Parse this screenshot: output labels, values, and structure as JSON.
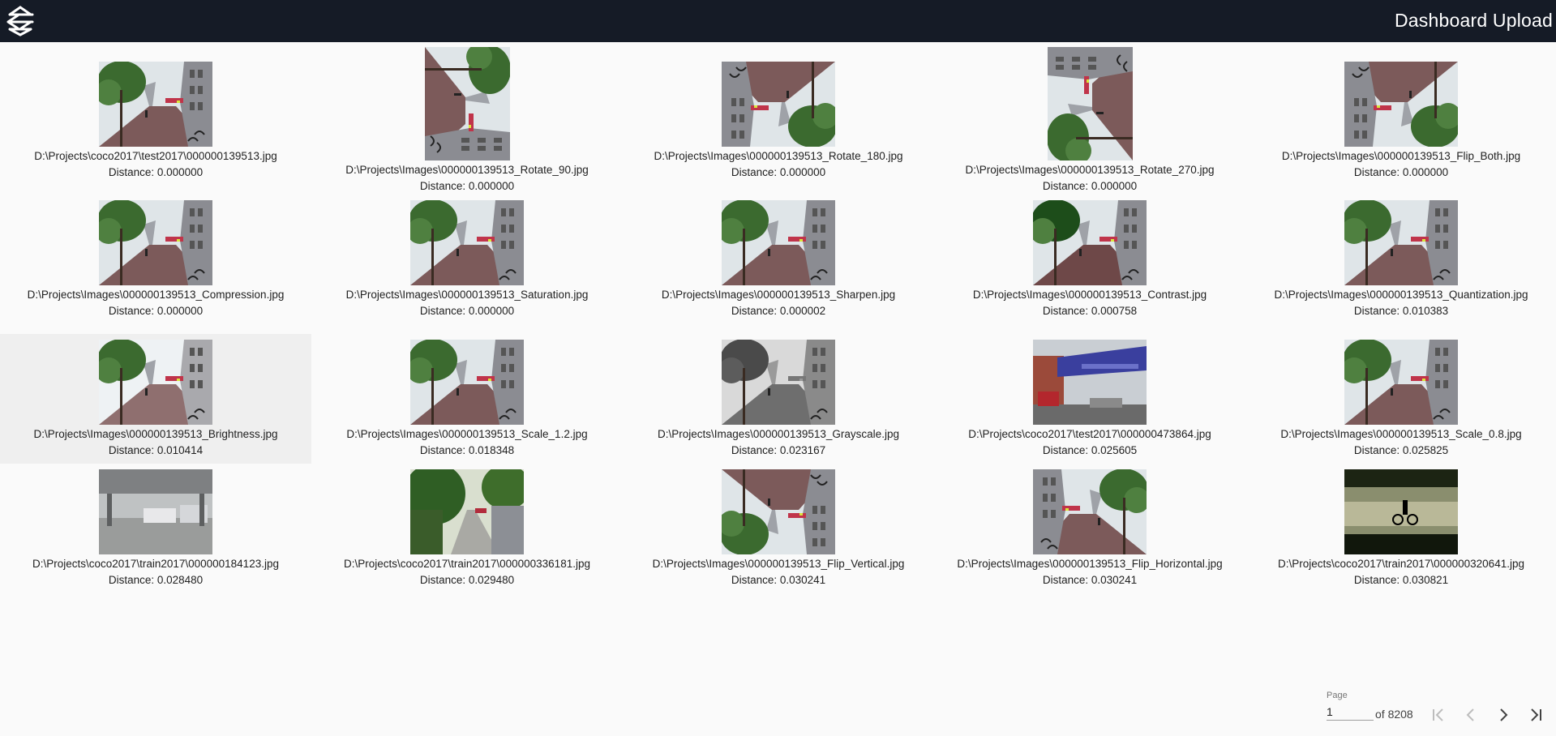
{
  "header": {
    "title": "Dashboard Upload",
    "logo_icon": "logo-icon"
  },
  "colors": {
    "topbar": "#151b26",
    "background": "#fafafa",
    "highlight": "#efefef"
  },
  "results": [
    {
      "path": "D:\\Projects\\coco2017\\test2017\\000000139513.jpg",
      "distance": "Distance: 0.000000",
      "orientation": "landscape",
      "variant": "street"
    },
    {
      "path": "D:\\Projects\\Images\\000000139513_Rotate_90.jpg",
      "distance": "Distance: 0.000000",
      "orientation": "portrait",
      "variant": "street-rot90"
    },
    {
      "path": "D:\\Projects\\Images\\000000139513_Rotate_180.jpg",
      "distance": "Distance: 0.000000",
      "orientation": "landscape",
      "variant": "street-rot180"
    },
    {
      "path": "D:\\Projects\\Images\\000000139513_Rotate_270.jpg",
      "distance": "Distance: 0.000000",
      "orientation": "portrait",
      "variant": "street-rot270"
    },
    {
      "path": "D:\\Projects\\Images\\000000139513_Flip_Both.jpg",
      "distance": "Distance: 0.000000",
      "orientation": "landscape",
      "variant": "street-rot180"
    },
    {
      "path": "D:\\Projects\\Images\\000000139513_Compression.jpg",
      "distance": "Distance: 0.000000",
      "orientation": "landscape",
      "variant": "street"
    },
    {
      "path": "D:\\Projects\\Images\\000000139513_Saturation.jpg",
      "distance": "Distance: 0.000000",
      "orientation": "landscape",
      "variant": "street"
    },
    {
      "path": "D:\\Projects\\Images\\000000139513_Sharpen.jpg",
      "distance": "Distance: 0.000002",
      "orientation": "landscape",
      "variant": "street"
    },
    {
      "path": "D:\\Projects\\Images\\000000139513_Contrast.jpg",
      "distance": "Distance: 0.000758",
      "orientation": "landscape",
      "variant": "street-contrast"
    },
    {
      "path": "D:\\Projects\\Images\\000000139513_Quantization.jpg",
      "distance": "Distance: 0.010383",
      "orientation": "landscape",
      "variant": "street"
    },
    {
      "path": "D:\\Projects\\Images\\000000139513_Brightness.jpg",
      "distance": "Distance: 0.010414",
      "orientation": "landscape",
      "variant": "street-bright",
      "highlighted": true
    },
    {
      "path": "D:\\Projects\\Images\\000000139513_Scale_1.2.jpg",
      "distance": "Distance: 0.018348",
      "orientation": "landscape",
      "variant": "street"
    },
    {
      "path": "D:\\Projects\\Images\\000000139513_Grayscale.jpg",
      "distance": "Distance: 0.023167",
      "orientation": "landscape",
      "variant": "street-gray"
    },
    {
      "path": "D:\\Projects\\coco2017\\test2017\\000000473864.jpg",
      "distance": "Distance: 0.025605",
      "orientation": "landscape",
      "variant": "bridge"
    },
    {
      "path": "D:\\Projects\\Images\\000000139513_Scale_0.8.jpg",
      "distance": "Distance: 0.025825",
      "orientation": "landscape",
      "variant": "street"
    },
    {
      "path": "D:\\Projects\\coco2017\\train2017\\000000184123.jpg",
      "distance": "Distance: 0.028480",
      "orientation": "landscape",
      "variant": "station"
    },
    {
      "path": "D:\\Projects\\coco2017\\train2017\\000000336181.jpg",
      "distance": "Distance: 0.029480",
      "orientation": "landscape",
      "variant": "treestreet"
    },
    {
      "path": "D:\\Projects\\Images\\000000139513_Flip_Vertical.jpg",
      "distance": "Distance: 0.030241",
      "orientation": "landscape",
      "variant": "street-flipv"
    },
    {
      "path": "D:\\Projects\\Images\\000000139513_Flip_Horizontal.jpg",
      "distance": "Distance: 0.030241",
      "orientation": "landscape",
      "variant": "street-fliph"
    },
    {
      "path": "D:\\Projects\\coco2017\\train2017\\000000320641.jpg",
      "distance": "Distance: 0.030821",
      "orientation": "landscape",
      "variant": "lake"
    }
  ],
  "paginator": {
    "label": "Page",
    "current": "1",
    "of_text": "of 8208",
    "icons": [
      "first-page-icon",
      "previous-page-icon",
      "next-page-icon",
      "last-page-icon"
    ]
  }
}
